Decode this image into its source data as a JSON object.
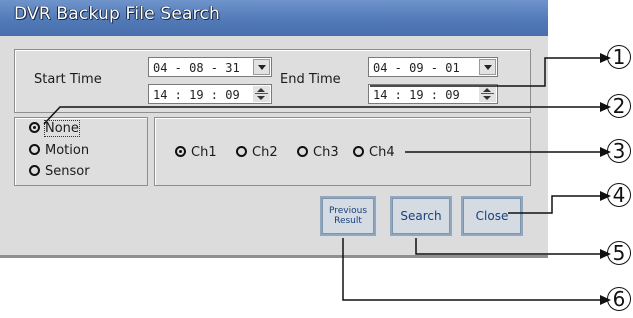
{
  "dialog": {
    "title": "DVR Backup File Search"
  },
  "time": {
    "start_label": "Start Time",
    "end_label": "End Time",
    "start_date": "04 - 08 - 31",
    "start_clock": "14 : 19 : 09",
    "end_date": "04 - 09 - 01",
    "end_clock": "14 : 19 : 09"
  },
  "modes": [
    {
      "label": "None",
      "selected": true
    },
    {
      "label": "Motion",
      "selected": false
    },
    {
      "label": "Sensor",
      "selected": false
    }
  ],
  "channels": [
    {
      "label": "Ch1",
      "selected": true
    },
    {
      "label": "Ch2",
      "selected": false
    },
    {
      "label": "Ch3",
      "selected": false
    },
    {
      "label": "Ch4",
      "selected": false
    }
  ],
  "buttons": {
    "previous_line1": "Previous",
    "previous_line2": "Result",
    "search": "Search",
    "close": "Close"
  },
  "callouts": [
    "1",
    "2",
    "3",
    "4",
    "5",
    "6"
  ]
}
